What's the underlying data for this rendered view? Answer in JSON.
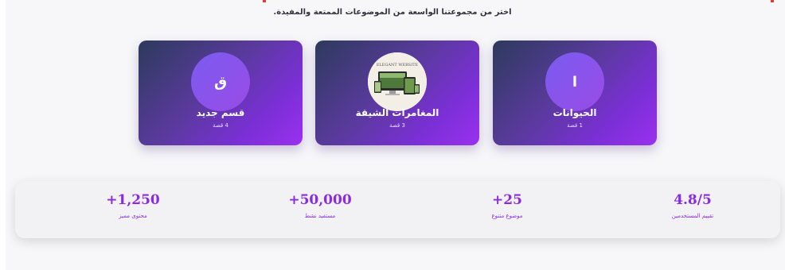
{
  "header": {
    "subtitle": "اختر من مجموعتنا الواسعة من الموضوعات الممتعة والمفيدة."
  },
  "categories": [
    {
      "title": "قسم جديد",
      "count": "4 قصة",
      "initial": "ق",
      "icon": "letter-avatar"
    },
    {
      "title": "المغامرات الشيقة",
      "count": "3 قصة",
      "icon": "website-preview-image",
      "image_caption": "ELEGANT WEBSITE"
    },
    {
      "title": "الحيوانات",
      "count": "1 قصة",
      "initial": "ا",
      "icon": "letter-avatar"
    }
  ],
  "stats": [
    {
      "value": "+1,250",
      "label": "محتوى مميز"
    },
    {
      "value": "+50,000",
      "label": "مستفيد نشط"
    },
    {
      "value": "+25",
      "label": "موضوع متنوع"
    },
    {
      "value": "4.8/5",
      "label": "تقييم المستخدمين"
    }
  ],
  "colors": {
    "accent": "#8a2be2",
    "card_gradient_start": "#2d3a5c",
    "card_gradient_end": "#9a30f0",
    "avatar": "#7a5cf0"
  }
}
